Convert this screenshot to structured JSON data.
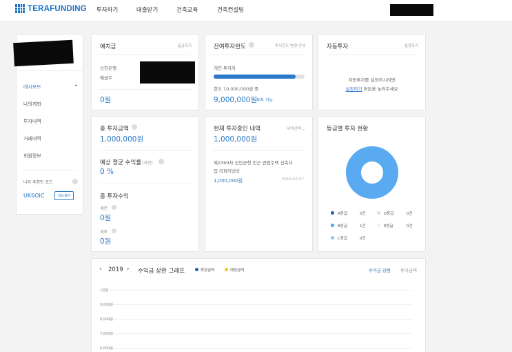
{
  "header": {
    "logo_text": "TERAFUNDING",
    "nav": [
      "투자하기",
      "대출받기",
      "건축교육",
      "건축컨설팅"
    ]
  },
  "sidebar": {
    "items": [
      "대시보드",
      "나의계좌",
      "투자내역",
      "거래내역",
      "회원정보"
    ],
    "active_index": 0,
    "referral_label": "나의 추천인 코드",
    "referral_code": "UK6OIC",
    "copy_label": "코드복사"
  },
  "deposit": {
    "title": "예치금",
    "link": "출금하기",
    "bank": "신한은행",
    "holder_label": "예금주",
    "amount": "0원"
  },
  "limit": {
    "title": "잔여투자한도",
    "link": "투자한도 변경 안내",
    "type": "개인 투자자",
    "progress": 0.9,
    "limit_text": "한도 10,000,000원 중",
    "available": "9,000,000원",
    "available_suffix": "투자 가능"
  },
  "auto": {
    "title": "자동투자",
    "link": "설정하기",
    "line1": "자동투자를 설정하시려면",
    "link2": "설정하기",
    "line2": " 버튼을 눌러주세요"
  },
  "total": {
    "title": "총 투자금액",
    "amount": "1,000,000원",
    "yield_title": "예상 평균 수익률",
    "yield_sub": "(세전)",
    "yield_value": "0 %",
    "profit_title": "총 투자수익",
    "pretax_label": "세전",
    "pretax_value": "0원",
    "aftertax_label": "세후",
    "aftertax_value": "0원"
  },
  "current": {
    "title": "현재 투자중인 내역",
    "filter": "내역선택",
    "amount": "1,000,000원",
    "item_line1": "제2369차 진안군청 인근 연립주택 신축사",
    "item_line2": "업 리파이낸싱",
    "item_amount": "1,000,000원",
    "item_date": "2019-02-07"
  },
  "grade": {
    "title": "등급별 투자 현황",
    "legend": [
      {
        "label": "A등급",
        "count": "0건",
        "color": "#1f5fa8"
      },
      {
        "label": "D등급",
        "count": "0건",
        "color": "#cfe3f6"
      },
      {
        "label": "B등급",
        "count": "1건",
        "color": "#4aa0f0"
      },
      {
        "label": "E등급",
        "count": "0건",
        "color": "#e8f2fb"
      },
      {
        "label": "C등급",
        "count": "0건",
        "color": "#8fc4f2"
      }
    ]
  },
  "graph": {
    "year": "2019",
    "title": "수익금 상환 그래프",
    "legend_confirmed": "확정금액",
    "legend_expected": "예정금액",
    "tab_active": "수익금 상환",
    "tab_other": "투자금액",
    "yticks": [
      "1만원",
      "9,000원",
      "8,000원",
      "7,000원",
      "6,000원"
    ]
  },
  "colors": {
    "accent": "#2a78c8",
    "donut": "#5aaaf2",
    "confirmed": "#1f5fa8",
    "expected": "#f5c518"
  }
}
